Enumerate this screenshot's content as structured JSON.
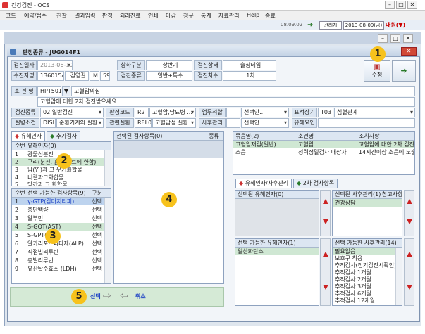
{
  "app": {
    "title": "건강검진 - OCS"
  },
  "menu": [
    "코드",
    "예약/접수",
    "진찰",
    "결과입력",
    "판정",
    "외래진료",
    "인쇄",
    "마감",
    "청구",
    "통계",
    "자료관리",
    "Help",
    "종료"
  ],
  "toolbar": {
    "date": "08.09.02",
    "user": "관리자",
    "date2": "2013-08-09(금)",
    "myinfo": "내원(▼)"
  },
  "inner": {
    "title": "판정종류 - JUG014F1",
    "close": "✕"
  },
  "form": {
    "exam_date_label": "검진일자",
    "exam_date": "2013-06-10",
    "half_label": "상하구분",
    "half": "상반기",
    "status_label": "검진상태",
    "status": "출장테임",
    "name_label": "수진자명",
    "chart_no": "13601549",
    "name": "김영길",
    "sex": "M",
    "age": "59",
    "type_label": "검진종류",
    "type": "일반+특수",
    "round_label": "검진차수",
    "round": "1차",
    "save_label": "수정",
    "finding_label": "소 견 명",
    "finding_code": "HPT501",
    "finding_name": "고혈압의심",
    "finding_desc": "고혈압에 대한 2차 검진받으세요.",
    "exam_kind_label": "검진종류",
    "exam_kind": "02  일반검진",
    "judge_code_label": "판정코드",
    "judge_code": "R2",
    "judge_code_name": "고혈압,당뇨병 ...",
    "work_fit_label": "업무적합",
    "work_fit": "",
    "select_placeholder": "선택안...",
    "target_organ_label": "표적장기",
    "target_organ": "T03",
    "target_organ_name": "심혈관계",
    "disease_label": "질병소견",
    "disease": "DISI",
    "disease_name": "순환기계의 질환",
    "related_label": "관련질환",
    "related": "REL03",
    "related_name": "고혈압성 질환",
    "after_label": "사후관리",
    "after": "",
    "harm_factor_label": "유해요인",
    "harm_factor": ""
  },
  "left_tabs": [
    "유해인자",
    "추가검사"
  ],
  "harm_list": {
    "headers": [
      "순번",
      "유해인자(0)"
    ],
    "rows": [
      {
        "no": "1",
        "name": "광물성분진"
      },
      {
        "no": "2",
        "name": "구리(분진, 흄 미스트에 한함)"
      },
      {
        "no": "3",
        "name": "납(연)과 그 무기화합물"
      },
      {
        "no": "4",
        "name": "니켈과그화합물"
      },
      {
        "no": "5",
        "name": "망간과 그 화합물"
      }
    ]
  },
  "test_list": {
    "headers": [
      "순번",
      "선택 가능한 검사항목(9)",
      "구분"
    ],
    "rows": [
      {
        "no": "1",
        "name": "γ-GTP(감마지티피)",
        "kind": "선택"
      },
      {
        "no": "2",
        "name": "총단백량",
        "kind": "선택"
      },
      {
        "no": "3",
        "name": "알부민",
        "kind": "선택"
      },
      {
        "no": "4",
        "name": "S-GOT(AST)",
        "kind": "선택"
      },
      {
        "no": "5",
        "name": "S-GPT(ALT)",
        "kind": "선택"
      },
      {
        "no": "6",
        "name": "알카리포스파타제(ALP)",
        "kind": "선택"
      },
      {
        "no": "7",
        "name": "직접빌리루빈",
        "kind": "선택"
      },
      {
        "no": "8",
        "name": "총빌리루빈",
        "kind": "선택"
      },
      {
        "no": "9",
        "name": "유산탈수효소 (LDH)",
        "kind": "선택"
      }
    ]
  },
  "selected_tests": {
    "headers": [
      "선택된 검사항목(0)",
      "종류"
    ]
  },
  "bundle": {
    "headers": [
      "묶음명(2)",
      "소견명",
      "조치사항"
    ],
    "rows": [
      {
        "a": "고혈압재검(일반)",
        "b": "고혈압",
        "c": "고혈압에 대한 2차 검진받"
      },
      {
        "a": "소음",
        "b": "청력정밀검사 대상자",
        "c": "14시간이상 소음에 노출되"
      }
    ]
  },
  "right_tabs": [
    "유해인자/사후관리",
    "2차 검사항목"
  ],
  "sel_harm": {
    "header": "선택된 유해인자(0)"
  },
  "avail_harm": {
    "header": "선택 가능한 유해인자(1)",
    "rows": [
      "일산화탄소"
    ]
  },
  "sel_after": {
    "header1": "선택된 사후관리(1)",
    "header2": "참고사항",
    "rows": [
      "건강상담"
    ]
  },
  "avail_after": {
    "header": "선택 가능한 사후관리(14)",
    "rows": [
      "필요없음",
      "보호구 착용",
      "추적검사(정기검진시확인)",
      "추적검사 1개월",
      "추적검사 2개월",
      "추적검사 3개월",
      "추적검사 6개월",
      "추적검사 12개월"
    ]
  },
  "bottom": {
    "select_label": "선택",
    "cancel_label": "취소"
  },
  "badges": [
    "1",
    "2",
    "3",
    "4",
    "5"
  ]
}
